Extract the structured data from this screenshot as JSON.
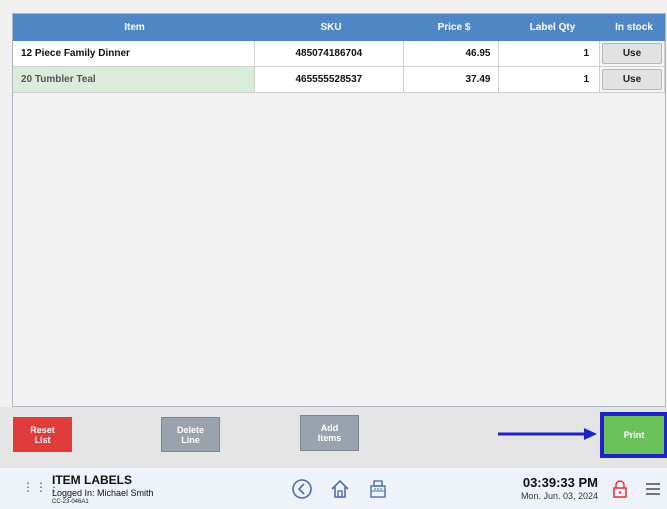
{
  "table": {
    "headers": [
      "Item",
      "SKU",
      "Price $",
      "Label Qty",
      "In stock"
    ],
    "rows": [
      {
        "item": "12 Piece Family Dinner",
        "sku": "485074186704",
        "price": "46.95",
        "qty": "1",
        "action": "Use"
      },
      {
        "item": "20 Tumbler Teal",
        "sku": "465555528537",
        "price": "37.49",
        "qty": "1",
        "action": "Use"
      }
    ]
  },
  "actions": {
    "reset": "Reset\nList",
    "delete": "Delete\nLine",
    "add": "Add\nItems",
    "print": "Print"
  },
  "status": {
    "title": "ITEM LABELS",
    "logged_in": "Logged In:  Michael Smith",
    "station": "CC-23-046A1",
    "time": "03:39:33 PM",
    "date": "Mon. Jun. 03, 2024"
  },
  "icons": [
    "app-grid-icon",
    "back-icon",
    "home-icon",
    "register-icon",
    "lock-icon",
    "menu-icon",
    "arrow-icon"
  ],
  "colors": {
    "header": "#4f86c6",
    "reset": "#e03c3c",
    "print": "#6ac15a",
    "highlight": "#1f22c8"
  }
}
